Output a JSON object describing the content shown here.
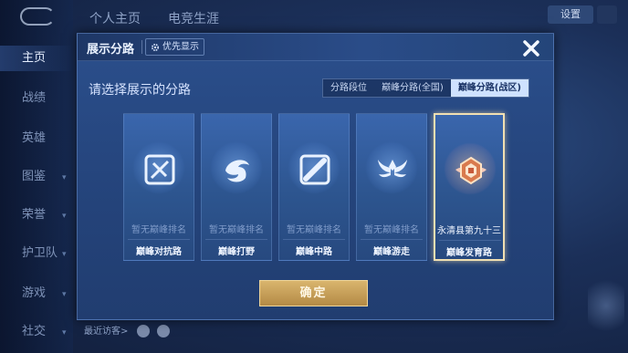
{
  "background": {
    "top_tabs": [
      "个人主页",
      "电竞生涯"
    ],
    "top_right_button": "设置",
    "sidebar": [
      "主页",
      "战绩",
      "英雄",
      "图鉴",
      "荣誉",
      "护卫队",
      "游戏",
      "社交"
    ],
    "bottom_text": "最近访客>"
  },
  "modal": {
    "title": "展示分路",
    "priority_button": "优先显示",
    "prompt": "请选择展示的分路",
    "segments": [
      "分路段位",
      "巅峰分路(全国)",
      "巅峰分路(战区)"
    ],
    "active_segment_index": 2,
    "cards": [
      {
        "rank": "暂无巅峰排名",
        "name": "巅峰对抗路",
        "icon": "sword-cross-icon",
        "selected": false
      },
      {
        "rank": "暂无巅峰排名",
        "name": "巅峰打野",
        "icon": "dragon-icon",
        "selected": false
      },
      {
        "rank": "暂无巅峰排名",
        "name": "巅峰中路",
        "icon": "staff-icon",
        "selected": false
      },
      {
        "rank": "暂无巅峰排名",
        "name": "巅峰游走",
        "icon": "wings-icon",
        "selected": false
      },
      {
        "rank": "永清县第九十三",
        "name": "巅峰发育路",
        "icon": "badge-icon",
        "selected": true
      }
    ],
    "confirm_button": "确定"
  },
  "colors": {
    "accent_gold": "#d9b56e",
    "selected_border": "#f0dfb2",
    "active_segment": "#cfe2ff"
  }
}
